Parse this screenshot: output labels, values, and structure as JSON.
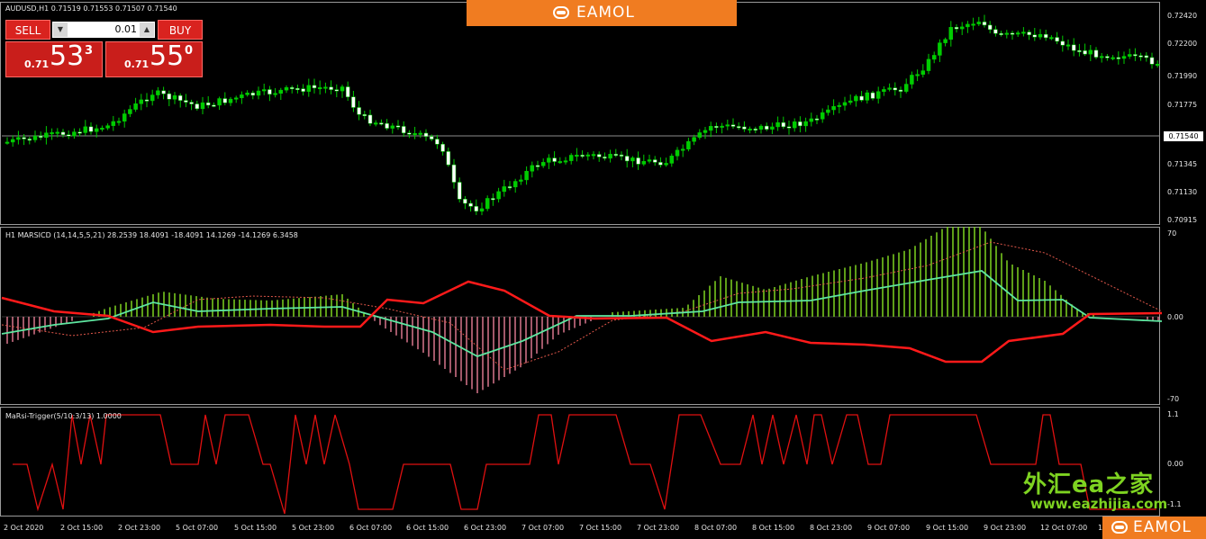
{
  "chart": {
    "symbol_header": "AUDUSD,H1  0.71519 0.71553 0.71507 0.71540",
    "current_price": "0.71540",
    "price_axis": [
      "0.72420",
      "0.72200",
      "0.71990",
      "0.71775",
      "0.71560",
      "0.71345",
      "0.71130",
      "0.70915"
    ],
    "colors": {
      "bull": "#00cc00",
      "bear": "#ffffff",
      "price_line": "#8c8c8c"
    }
  },
  "trade_panel": {
    "sell_label": "SELL",
    "buy_label": "BUY",
    "lot_value": "0.01",
    "sell_prefix": "0.71",
    "sell_big": "53",
    "sell_sup": "3",
    "buy_prefix": "0.71",
    "buy_big": "55",
    "buy_sup": "0"
  },
  "indicator1": {
    "label": "H1 MARSICD (14,14,5,5,21) 28.2539 18.4091 -18.4091 14.1269 -14.1269 6.3458",
    "axis": [
      "70",
      "0.00",
      "-70"
    ],
    "colors": {
      "hist_pos": "#7ed321",
      "hist_neg": "#d9768c",
      "red": "#ff1a1a",
      "teal": "#5ee6a0",
      "dotted": "#e0574a"
    }
  },
  "indicator2": {
    "label": "MaRsi-Trigger(5/10:3/13) 1.0000",
    "axis": [
      "1.1",
      "0.00",
      "-1.1"
    ],
    "colors": {
      "line": "#e01010"
    }
  },
  "time_axis": [
    "2 Oct 2020",
    "2 Oct 15:00",
    "2 Oct 23:00",
    "5 Oct 07:00",
    "5 Oct 15:00",
    "5 Oct 23:00",
    "6 Oct 07:00",
    "6 Oct 15:00",
    "6 Oct 23:00",
    "7 Oct 07:00",
    "7 Oct 15:00",
    "7 Oct 23:00",
    "8 Oct 07:00",
    "8 Oct 15:00",
    "8 Oct 23:00",
    "9 Oct 07:00",
    "9 Oct 15:00",
    "9 Oct 23:00",
    "12 Oct 07:00",
    "12"
  ],
  "watermarks": {
    "brand": "EAMOL",
    "site_title": "外汇ea之家",
    "site_url": "www.eazhijia.com"
  }
}
